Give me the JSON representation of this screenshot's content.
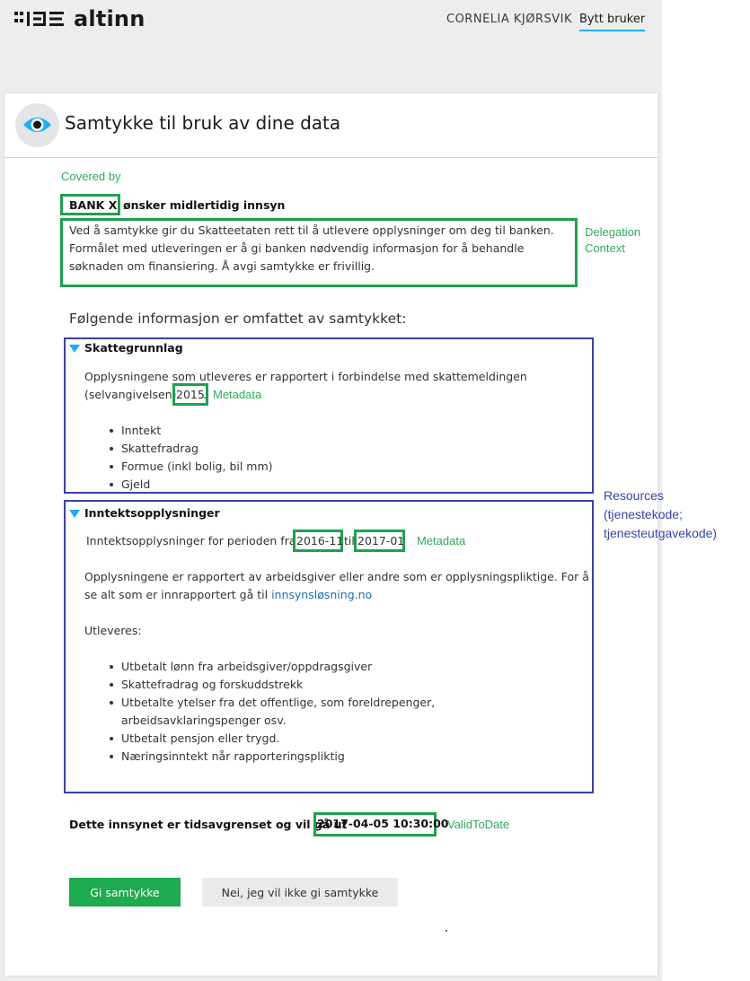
{
  "header": {
    "logo_text": "altinn",
    "user_name": "CORNELIA KJØRSVIK",
    "switch_user": "Bytt bruker"
  },
  "card": {
    "title": "Samtykke til bruk av dine data"
  },
  "annotations": {
    "covered_by": "Covered by",
    "delegation_context_1": "Delegation",
    "delegation_context_2": "Context",
    "metadata_1": "Metadata",
    "metadata_2": "Metadata",
    "resources_1": "Resources",
    "resources_2": "(tjenestekode;",
    "resources_3": "tjenesteutgavekode)",
    "valid_to_date": "ValidToDate"
  },
  "request": {
    "requester": "BANK X",
    "requester_suffix": "ønsker midlertidig innsyn",
    "context_text": "Ved å samtykke gir du Skatteetaten rett til å utlevere opplysninger om deg til banken. Formålet med utleveringen er å gi banken nødvendig informasjon for å behandle søknaden om finansiering. Å avgi samtykke er frivillig."
  },
  "scope_heading": "Følgende informasjon er omfattet av samtykket:",
  "sections": [
    {
      "title": "Skattegrunnlag",
      "desc_line1": "Opplysningene som utleveres er rapportert i forbindelse med skattemeldingen",
      "desc_line2_prefix": "(selvangivelsen)",
      "year": "2015",
      "year_suffix": ".",
      "items": [
        "Inntekt",
        "Skattefradrag",
        "Formue (inkl bolig, bil mm)",
        "Gjeld"
      ]
    },
    {
      "title": "Inntektsopplysninger",
      "period_prefix": "Inntektsopplysninger for perioden fra",
      "from": "2016-11",
      "mid": "til",
      "to": "2017-01",
      "info_line1": "Opplysningene er rapportert av arbeidsgiver eller andre som er opplysningspliktige. For å",
      "info_line2_prefix": "se alt som er innrapportert gå til",
      "info_link": "innsynsløsning.no",
      "released_label": "Utleveres:",
      "items": [
        "Utbetalt lønn fra arbeidsgiver/oppdragsgiver",
        "Skattefradrag og forskuddstrekk",
        "Utbetalte ytelser fra det offentlige, som foreldrepenger, arbeidsavklaringspenger osv.",
        "Utbetalt pensjon eller trygd.",
        "Næringsinntekt når rapporteringspliktig"
      ]
    }
  ],
  "expiry": {
    "prefix": "Dette innsynet er tidsavgrenset og vil gå ut",
    "date": "2017-04-05 10:30:00"
  },
  "buttons": {
    "accept": "Gi samtykke",
    "reject": "Nei, jeg vil ikke gi samtykke"
  },
  "colors": {
    "accent_blue": "#1eaef7",
    "accept_green": "#1eaa50",
    "annotation_green": "#20a04e",
    "annotation_blue": "#3b3fa5"
  }
}
